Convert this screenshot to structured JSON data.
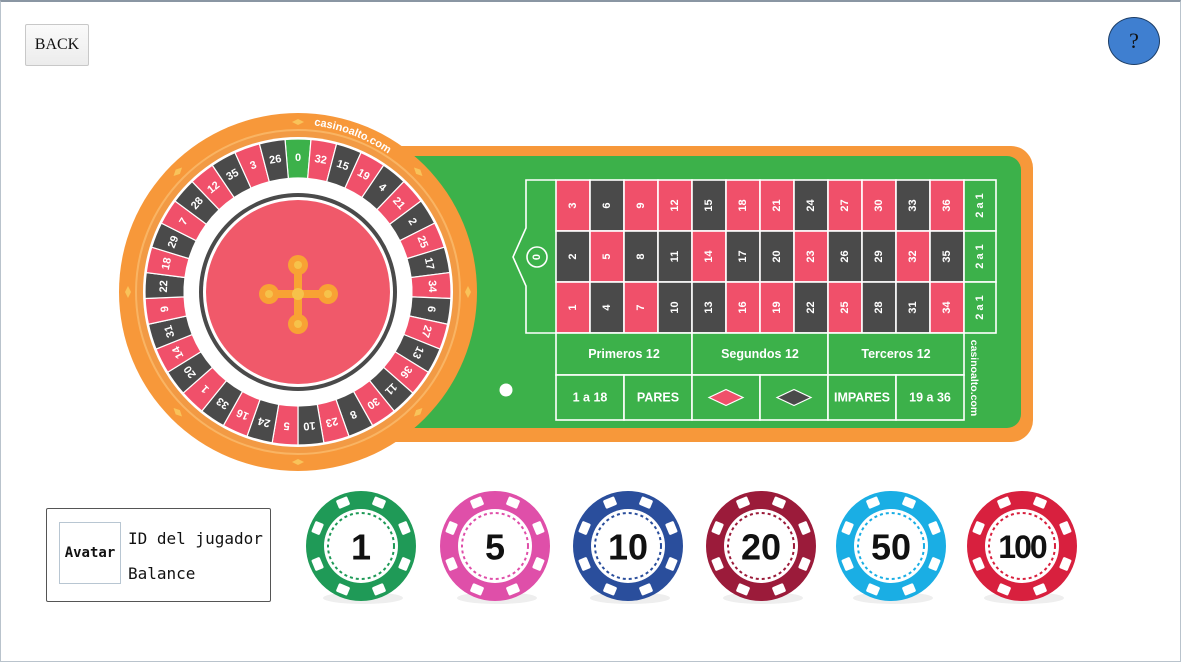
{
  "buttons": {
    "back_label": "BACK",
    "help_label": "?"
  },
  "wheel": {
    "brand": "casinoalto.com",
    "numbers": [
      "0",
      "32",
      "15",
      "19",
      "4",
      "21",
      "2",
      "25",
      "17",
      "34",
      "6",
      "27",
      "13",
      "36",
      "11",
      "30",
      "8",
      "23",
      "10",
      "5",
      "24",
      "16",
      "33",
      "1",
      "20",
      "14",
      "31",
      "9",
      "22",
      "18",
      "29",
      "7",
      "28",
      "12",
      "35",
      "3",
      "26"
    ],
    "colors": [
      "green",
      "red",
      "black",
      "red",
      "black",
      "red",
      "black",
      "red",
      "black",
      "red",
      "black",
      "red",
      "black",
      "red",
      "black",
      "red",
      "black",
      "red",
      "black",
      "red",
      "black",
      "red",
      "black",
      "red",
      "black",
      "red",
      "black",
      "red",
      "black",
      "red",
      "black",
      "red",
      "black",
      "red",
      "black",
      "red",
      "black"
    ]
  },
  "board": {
    "zero": "0",
    "brand": "casinoalto.com",
    "columns": [
      [
        "3",
        "2",
        "1"
      ],
      [
        "6",
        "5",
        "4"
      ],
      [
        "9",
        "8",
        "7"
      ],
      [
        "12",
        "11",
        "10"
      ],
      [
        "15",
        "14",
        "13"
      ],
      [
        "18",
        "17",
        "16"
      ],
      [
        "21",
        "20",
        "19"
      ],
      [
        "24",
        "23",
        "22"
      ],
      [
        "27",
        "26",
        "25"
      ],
      [
        "30",
        "29",
        "28"
      ],
      [
        "33",
        "32",
        "31"
      ],
      [
        "36",
        "35",
        "34"
      ]
    ],
    "column_bets": [
      "2 a 1",
      "2 a 1",
      "2 a 1"
    ],
    "dozens": [
      "Primeros 12",
      "Segundos 12",
      "Terceros 12"
    ],
    "outside": [
      "1 a 18",
      "PARES",
      "IMPARES",
      "19 a 36"
    ],
    "outside_symbols": [
      "red-diamond",
      "black-diamond"
    ]
  },
  "player": {
    "avatar_label": "Avatar",
    "id_label": "ID del jugador",
    "balance_label": "Balance"
  },
  "chips": [
    {
      "value": "1",
      "color": "#1f9a57"
    },
    {
      "value": "5",
      "color": "#df4fa9"
    },
    {
      "value": "10",
      "color": "#2a4e9c"
    },
    {
      "value": "20",
      "color": "#9b1b3a"
    },
    {
      "value": "50",
      "color": "#1aaee4"
    },
    {
      "value": "100",
      "color": "#d8203e"
    }
  ],
  "colors": {
    "felt": "#3cb14a",
    "frame": "#f7983a",
    "red": "#f0506a",
    "black": "#4a4a4a",
    "green": "#3cb14a"
  }
}
